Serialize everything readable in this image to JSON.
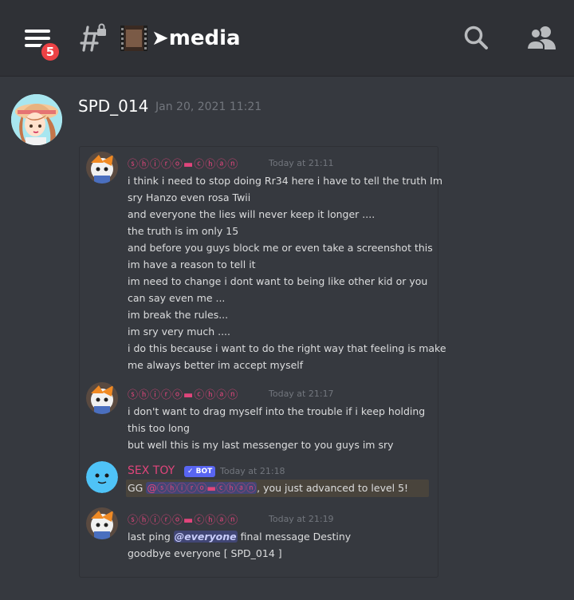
{
  "header": {
    "notification_count": "5",
    "channel_name": "➤media"
  },
  "post": {
    "author": "SPD_014",
    "timestamp": "Jan 20, 2021 11:21"
  },
  "embedded_screenshot": {
    "messages": [
      {
        "author": "ⓢⓗⓘⓡⓞ▬ⓒⓗⓐⓝ",
        "timestamp": "Today at 21:11",
        "lines": [
          "i think i need to stop doing Rr34 here i have to tell the truth Im",
          "sry Hanzo even rosa Twii",
          "and everyone the lies will never keep it longer ....",
          "the truth is im only 15",
          "and before you guys block me or even take a screenshot this",
          "im have a reason to tell it",
          "im need to change i dont want to being like other kid or you",
          "can say even me ...",
          "im break the rules...",
          "im sry very much ....",
          "i do this because i want to do the right way that feeling is make",
          "me always better im accept myself"
        ]
      },
      {
        "author": "ⓢⓗⓘⓡⓞ▬ⓒⓗⓐⓝ",
        "timestamp": "Today at 21:17",
        "lines": [
          "i don't want to drag myself into the trouble if i keep holding",
          "this too long",
          "but well this is my last messenger to you guys im sry"
        ]
      },
      {
        "author": "SEX TOY",
        "bot_tag": "✓ BOT",
        "timestamp": "Today at 21:18",
        "line_prefix": "GG ",
        "line_mention": "@ⓢⓗⓘⓡⓞ▬ⓒⓗⓐⓝ",
        "line_suffix": ", you just advanced to level 5!"
      },
      {
        "author": "ⓢⓗⓘⓡⓞ▬ⓒⓗⓐⓝ",
        "timestamp": "Today at 21:19",
        "line1_prefix": "last ping ",
        "line1_mention": "@everyone",
        "line1_suffix": " final message Destiny",
        "line2": "goodbye everyone [ SPD_014 ]"
      }
    ]
  },
  "colors": {
    "background": "#36393f",
    "topbar": "#2f3136",
    "badge": "#ed4245",
    "author_pink": "#e0457b",
    "bot_tag": "#5865f2"
  },
  "icons": {
    "menu": "hamburger-menu-icon",
    "channel": "locked-hash-icon",
    "film": "film-frame-icon",
    "search": "search-icon",
    "members": "members-icon"
  }
}
